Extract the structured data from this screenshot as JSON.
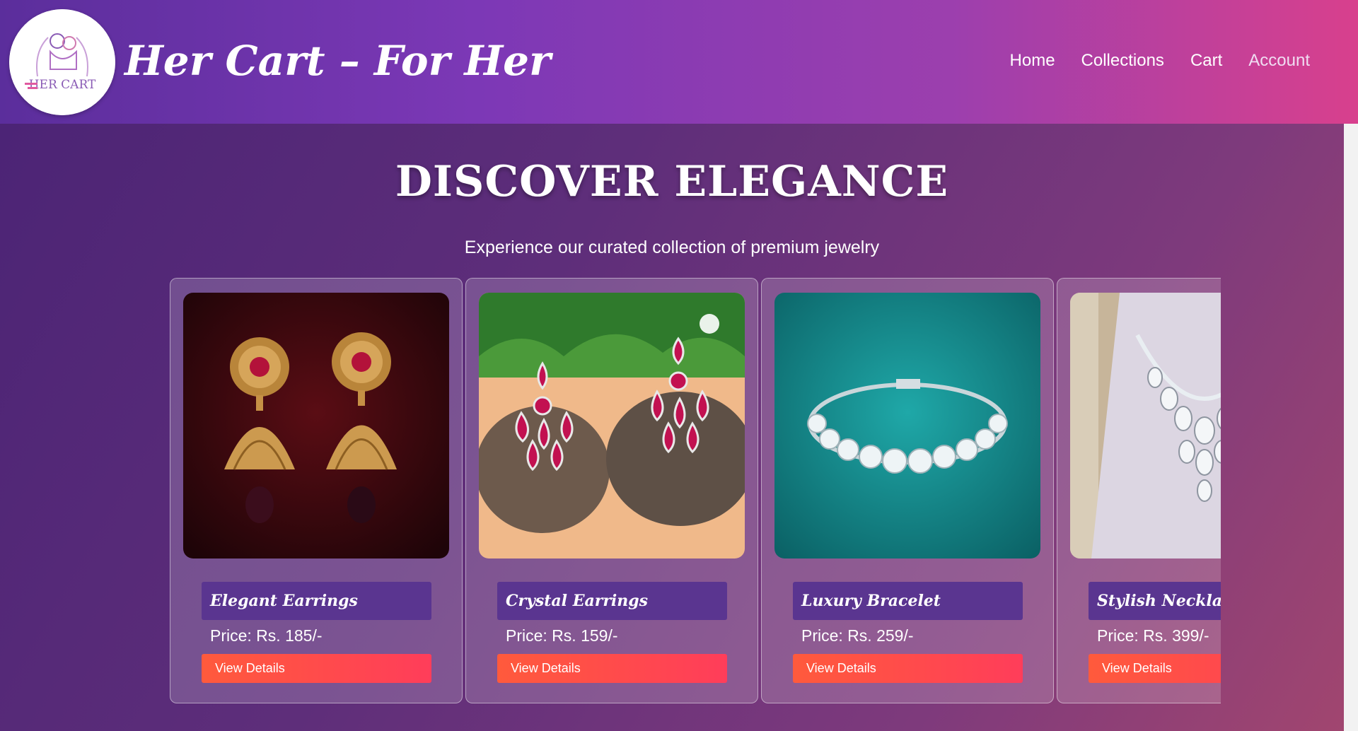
{
  "header": {
    "logo_alt": "HER CART",
    "title": "Her Cart – For Her",
    "nav": [
      "Home",
      "Collections",
      "Cart",
      "Account"
    ]
  },
  "hero": {
    "title": "DISCOVER ELEGANCE",
    "subtitle": "Experience our curated collection of premium jewelry"
  },
  "products": [
    {
      "name": "Elegant Earrings",
      "price": "Price: Rs. 185/-",
      "button": "View Details",
      "image": "gold-jhumka-earrings"
    },
    {
      "name": "Crystal Earrings",
      "price": "Price: Rs. 159/-",
      "button": "View Details",
      "image": "ruby-crystal-earrings"
    },
    {
      "name": "Luxury Bracelet",
      "price": "Price: Rs. 259/-",
      "button": "View Details",
      "image": "diamond-tennis-bracelet"
    },
    {
      "name": "Stylish Necklace",
      "price": "Price: Rs. 399/-",
      "button": "View Details",
      "image": "crystal-statement-necklace"
    }
  ],
  "colors": {
    "header_start": "#5b2e9c",
    "header_end": "#d8408d",
    "card_label": "#5a3590",
    "button": "#ff4a4a"
  }
}
